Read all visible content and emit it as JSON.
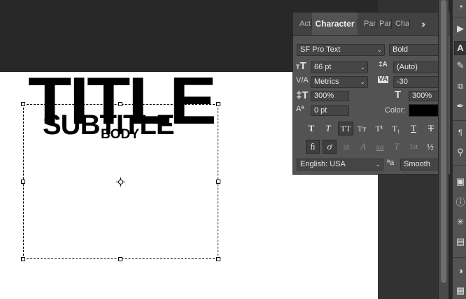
{
  "canvas": {
    "title_text": "TITLE",
    "subtitle_text": "SUBTITLE",
    "body_text": "BODY"
  },
  "character_panel": {
    "tabs": [
      {
        "label": "Act"
      },
      {
        "label": "Character"
      },
      {
        "label": "Par"
      },
      {
        "label": "Par"
      },
      {
        "label": "Cha"
      }
    ],
    "font_family": "SF Pro Text",
    "font_style": "Bold",
    "font_size": "66 pt",
    "leading": "(Auto)",
    "kerning": "Metrics",
    "tracking": "-30",
    "vertical_scale": "300%",
    "horizontal_scale": "300%",
    "baseline_shift": "0 pt",
    "color_label": "Color:",
    "color_value": "#000000",
    "language": "English: USA",
    "aa_label": "ªa",
    "antialias": "Smooth",
    "type_style_buttons": [
      "T",
      "T",
      "TT",
      "Tт",
      "T¹",
      "T₁",
      "T",
      "T"
    ],
    "opentype_buttons": [
      "ﬁ",
      "ơ",
      "st",
      "A",
      "aa",
      "T",
      "1st",
      "½"
    ]
  }
}
